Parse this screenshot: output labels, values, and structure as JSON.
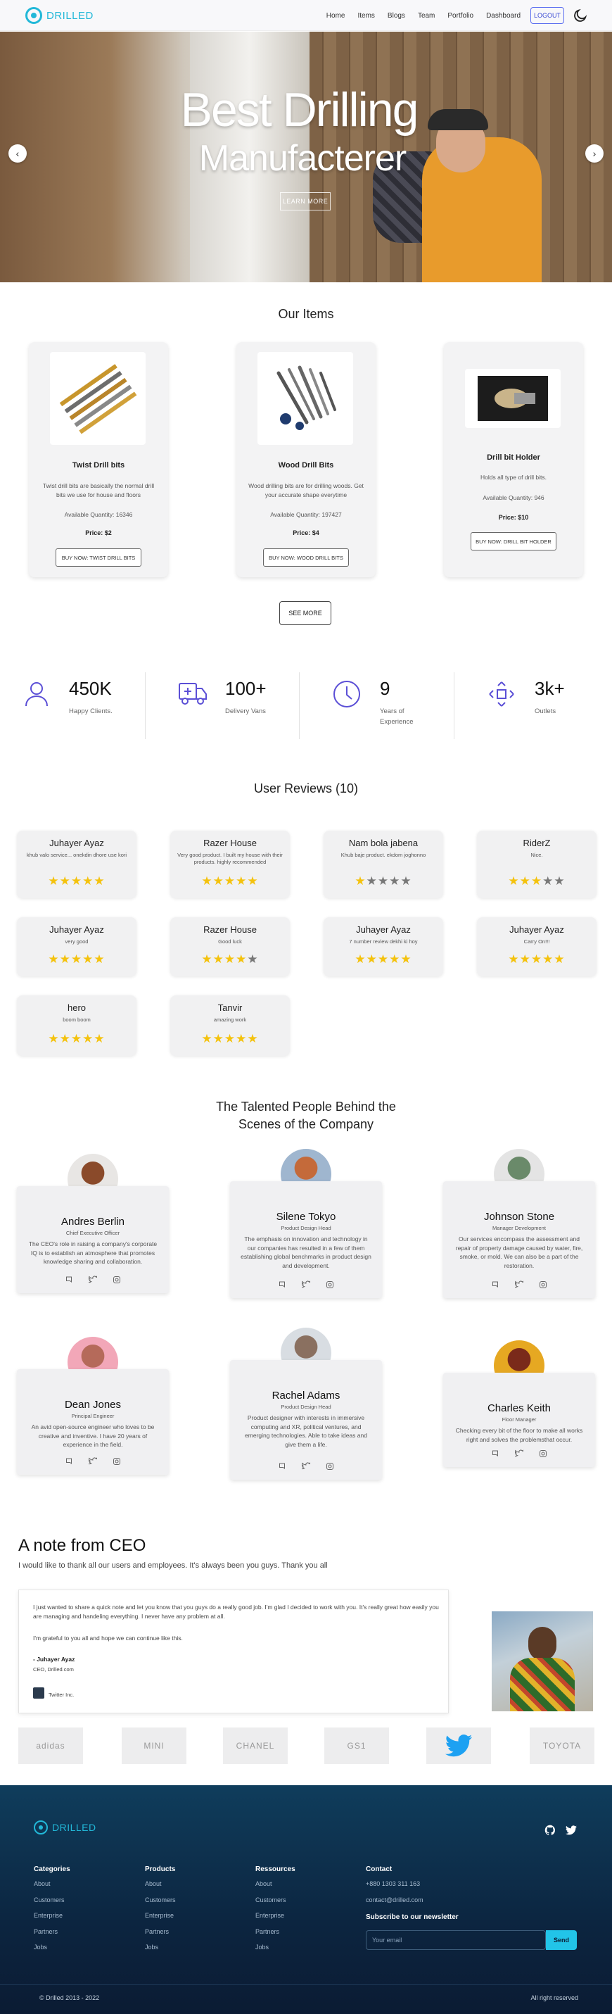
{
  "nav": {
    "brand": "DRILLED",
    "links": [
      "Home",
      "Items",
      "Blogs",
      "Team",
      "Portfolio",
      "Dashboard"
    ],
    "logout": "LOGOUT"
  },
  "hero": {
    "title_line1": "Best Drilling",
    "title_line2": "Manufacterer",
    "cta": "LEARN MORE"
  },
  "items_section": {
    "title": "Our Items",
    "items": [
      {
        "name": "Twist Drill bits",
        "desc": "Twist drill bits are basically the normal drill bits we use for house and floors",
        "qty": "Available Quantity: 16346",
        "price": "Price: $2",
        "buy": "BUY NOW: TWIST DRILL BITS"
      },
      {
        "name": "Wood Drill Bits",
        "desc": "Wood drilling bits are for drilling woods. Get your accurate shape everytime",
        "qty": "Available Quantity: 197427",
        "price": "Price: $4",
        "buy": "BUY NOW: WOOD DRILL BITS"
      },
      {
        "name": "Drill bit Holder",
        "desc": "Holds all type of drill bits.",
        "qty": "Available Quantity: 946",
        "price": "Price: $10",
        "buy": "BUY NOW: DRILL BIT HOLDER"
      }
    ],
    "see_more": "SEE MORE"
  },
  "stats": [
    {
      "value": "450K",
      "label": "Happy Clients.",
      "icon": "user-icon"
    },
    {
      "value": "100+",
      "label": "Delivery Vans",
      "icon": "van-icon"
    },
    {
      "value": "9",
      "label": "Years of Experience",
      "icon": "clock-icon"
    },
    {
      "value": "3k+",
      "label": "Outlets",
      "icon": "expand-icon"
    }
  ],
  "reviews": {
    "title": "User Reviews (10)",
    "items": [
      {
        "name": "Juhayer Ayaz",
        "text": "khub valo service... onekdin dhore use kori",
        "rating": 5
      },
      {
        "name": "Razer House",
        "text": "Very good product. I built my house with their products. highly recommended",
        "rating": 5
      },
      {
        "name": "Nam bola jabena",
        "text": "Khub baje product. ekdom joghonno",
        "rating": 1
      },
      {
        "name": "RiderZ",
        "text": "Nice.",
        "rating": 3
      },
      {
        "name": "Juhayer Ayaz",
        "text": "very good",
        "rating": 5
      },
      {
        "name": "Razer House",
        "text": "Good luck",
        "rating": 4
      },
      {
        "name": "Juhayer Ayaz",
        "text": "7 number review dekhi ki hoy",
        "rating": 5
      },
      {
        "name": "Juhayer Ayaz",
        "text": "Carry On!!!",
        "rating": 5
      },
      {
        "name": "hero",
        "text": "boom boom",
        "rating": 5
      },
      {
        "name": "Tanvir",
        "text": "amazing work",
        "rating": 5
      }
    ]
  },
  "team": {
    "title_line1": "The Talented People Behind the",
    "title_line2": "Scenes of the Company",
    "members": [
      {
        "name": "Andres Berlin",
        "role": "Chief Executive Officer",
        "desc": "The CEO's role in raising a company's corporate IQ is to establish an atmosphere that promotes knowledge sharing and collaboration."
      },
      {
        "name": "Silene Tokyo",
        "role": "Product Design Head",
        "desc": "The emphasis on innovation and technology in our companies has resulted in a few of them establishing global benchmarks in product design and development."
      },
      {
        "name": "Johnson Stone",
        "role": "Manager Development",
        "desc": "Our services encompass the assessment and repair of property damage caused by water, fire, smoke, or mold. We can also be a part of the restoration."
      },
      {
        "name": "Dean Jones",
        "role": "Principal Engineer",
        "desc": "An avid open-source engineer who loves to be creative and inventive. I have 20 years of experience in the field."
      },
      {
        "name": "Rachel Adams",
        "role": "Product Design Head",
        "desc": "Product designer with interests in immersive computing and XR, political ventures, and emerging technologies. Able to take ideas and give them a life."
      },
      {
        "name": "Charles Keith",
        "role": "Floor Manager",
        "desc": "Checking every bit of the floor to make all works right and solves the problemsthat occur."
      }
    ]
  },
  "ceo": {
    "title": "A note from CEO",
    "subtitle": "I would like to thank all our users and employees. It's always been you guys. Thank you all",
    "para1": "I just wanted to share a quick note and let you know that you guys do a really good job. I'm glad I decided to work with you. It's really great how easily you are managing and handeling everything. I never have any problem at all.",
    "para2": "I'm grateful to you all and hope we can continue like this.",
    "sign_name": "- Juhayer Ayaz",
    "sign_role": "CEO, Drilled.com",
    "company": "Twitter Inc."
  },
  "brands": [
    "adidas",
    "MINI",
    "CHANEL",
    "GS1",
    "twitter",
    "TOYOTA"
  ],
  "footer": {
    "brand": "DRILLED",
    "columns": [
      {
        "title": "Categories",
        "links": [
          "About",
          "Customers",
          "Enterprise",
          "Partners",
          "Jobs"
        ]
      },
      {
        "title": "Products",
        "links": [
          "About",
          "Customers",
          "Enterprise",
          "Partners",
          "Jobs"
        ]
      },
      {
        "title": "Ressources",
        "links": [
          "About",
          "Customers",
          "Enterprise",
          "Partners",
          "Jobs"
        ]
      }
    ],
    "contact_title": "Contact",
    "phone": "+880 1303 311 163",
    "email": "contact@drilled.com",
    "newsletter_title": "Subscribe to our newsletter",
    "email_placeholder": "Your email",
    "send": "Send",
    "copyright": "© Drilled 2013 - 2022",
    "rights": "All right reserved"
  },
  "colors": {
    "accent": "#22b8d8",
    "star": "#f4c20d",
    "footer_bg": "#0c2540",
    "nav_link": "#3a4ad4"
  }
}
